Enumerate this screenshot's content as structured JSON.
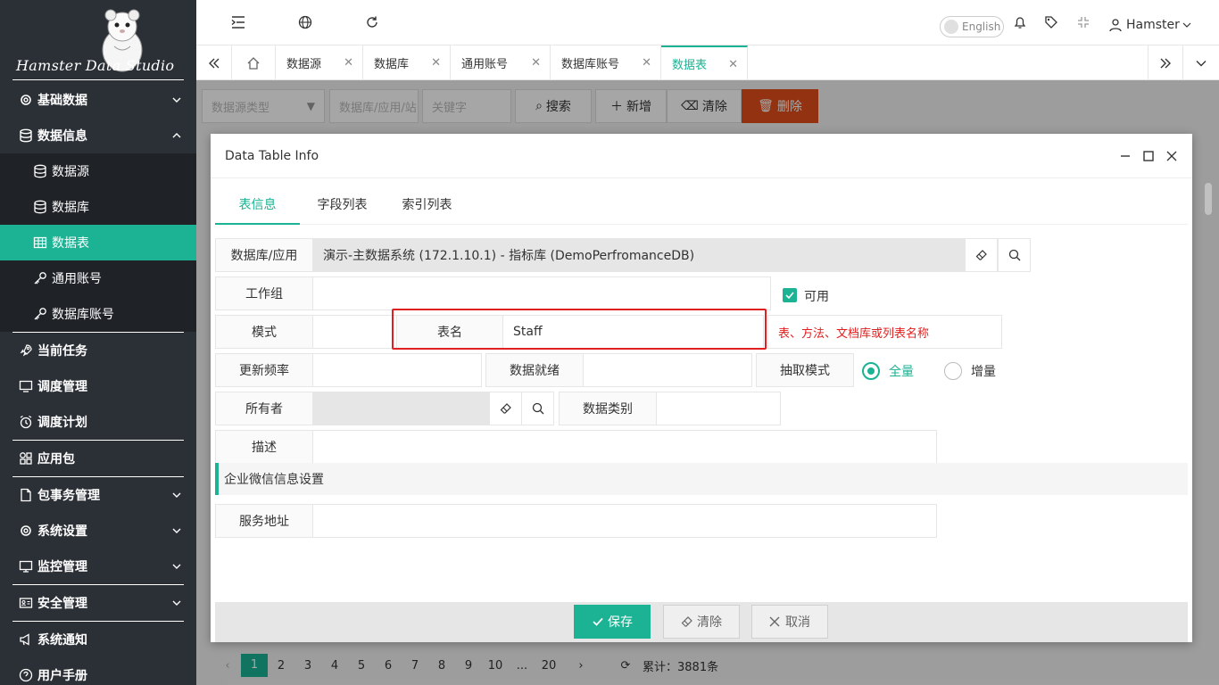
{
  "app": {
    "logo_text": "Hamster Data Studio"
  },
  "sidebar": {
    "items": [
      {
        "label": "基础数据",
        "icon": "gear-icon"
      },
      {
        "label": "数据信息",
        "icon": "database-icon"
      },
      {
        "label": "数据源",
        "icon": "database-icon"
      },
      {
        "label": "数据库",
        "icon": "database-icon"
      },
      {
        "label": "数据表",
        "icon": "table-icon"
      },
      {
        "label": "通用账号",
        "icon": "key-icon"
      },
      {
        "label": "数据库账号",
        "icon": "key-icon"
      },
      {
        "label": "当前任务",
        "icon": "rocket-icon"
      },
      {
        "label": "调度管理",
        "icon": "monitor-icon"
      },
      {
        "label": "调度计划",
        "icon": "alarm-icon"
      },
      {
        "label": "应用包",
        "icon": "apps-icon"
      },
      {
        "label": "包事务管理",
        "icon": "file-icon"
      },
      {
        "label": "系统设置",
        "icon": "gear-icon"
      },
      {
        "label": "监控管理",
        "icon": "monitor-icon"
      },
      {
        "label": "安全管理",
        "icon": "id-card-icon"
      },
      {
        "label": "系统通知",
        "icon": "megaphone-icon"
      },
      {
        "label": "用户手册",
        "icon": "help-icon"
      }
    ]
  },
  "topbar": {
    "language": "English",
    "user": "Hamster"
  },
  "tabs": [
    {
      "label": "数据源"
    },
    {
      "label": "数据库"
    },
    {
      "label": "通用账号"
    },
    {
      "label": "数据库账号"
    },
    {
      "label": "数据表"
    }
  ],
  "filters": {
    "source_type_placeholder": "数据源类型",
    "db_app_placeholder": "数据库/应用/站",
    "keyword_placeholder": "关键字",
    "search": "搜索",
    "add": "新增",
    "clear": "清除",
    "delete": "删除"
  },
  "pager": {
    "pages": [
      "1",
      "2",
      "3",
      "4",
      "5",
      "6",
      "7",
      "8",
      "9",
      "10",
      "...",
      "20"
    ],
    "total": "累计：3881条"
  },
  "dialog": {
    "title": "Data Table Info",
    "tabs": [
      "表信息",
      "字段列表",
      "索引列表"
    ],
    "fields": {
      "db_app_label": "数据库/应用",
      "db_app_value": "演示-主数据系统 (172.1.10.1) - 指标库 (DemoPerfromanceDB)",
      "workgroup_label": "工作组",
      "workgroup_value": "",
      "enabled_label": "可用",
      "schema_label": "模式",
      "schema_value": "",
      "table_name_label": "表名",
      "table_name_value": "Staff",
      "table_name_hint": "表、方法、文档库或列表名称",
      "update_freq_label": "更新频率",
      "update_freq_value": "",
      "data_ready_label": "数据就绪",
      "data_ready_value": "",
      "extract_mode_label": "抽取模式",
      "extract_full": "全量",
      "extract_incremental": "增量",
      "owner_label": "所有者",
      "owner_value": "",
      "data_category_label": "数据类别",
      "data_category_value": "",
      "description_label": "描述",
      "description_value": "",
      "wecom_section": "企业微信信息设置",
      "service_url_label": "服务地址",
      "service_url_value": ""
    },
    "buttons": {
      "save": "保存",
      "clear": "清除",
      "cancel": "取消"
    }
  },
  "colors": {
    "accent": "#1bb394",
    "danger": "#e04e1b",
    "sidebar": "#2b2f36",
    "hint": "#e02020"
  }
}
